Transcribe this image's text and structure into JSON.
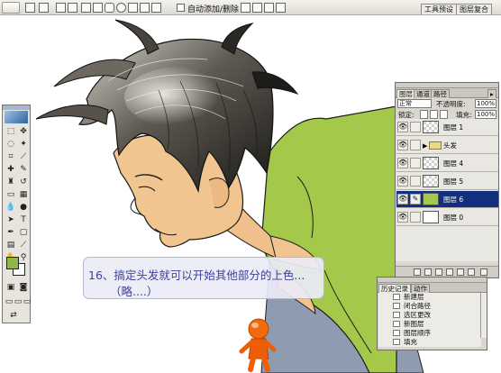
{
  "option_bar": {
    "auto_select_label": "自动添加/删除",
    "well_tabs": [
      "工具预设",
      "图层复合"
    ]
  },
  "layers_panel": {
    "tabs": [
      "图层",
      "通道",
      "路径"
    ],
    "blend_mode": "正常",
    "opacity_label": "不透明度:",
    "opacity_value": "100%",
    "lock_label": "锁定:",
    "fill_label": "填充:",
    "fill_value": "100%",
    "layers": [
      {
        "name": "图层 1",
        "visible": true,
        "selected": false,
        "folder": false
      },
      {
        "name": "头发",
        "visible": true,
        "selected": false,
        "folder": true
      },
      {
        "name": "图层 4",
        "visible": true,
        "selected": false,
        "folder": false
      },
      {
        "name": "图层 5",
        "visible": true,
        "selected": false,
        "folder": false
      },
      {
        "name": "图层 6",
        "visible": true,
        "selected": true,
        "folder": false
      },
      {
        "name": "图层 0",
        "visible": true,
        "selected": false,
        "folder": false
      }
    ]
  },
  "history_panel": {
    "tabs": [
      "历史记录",
      "动作"
    ],
    "items": [
      "新建层",
      "闭合路径",
      "选区更改",
      "新图层",
      "图层顺序",
      "填充"
    ]
  },
  "caption": {
    "line1": "16、搞定头发就可以开始其他部分的上色...",
    "line2": "（略....）"
  },
  "colors": {
    "foreground": "#8db848",
    "background": "#ffffff",
    "shirt": "#a3c84a",
    "skin": "#f1c590",
    "panel_selected": "#12307e",
    "caption_text": "#3b3f9a"
  }
}
